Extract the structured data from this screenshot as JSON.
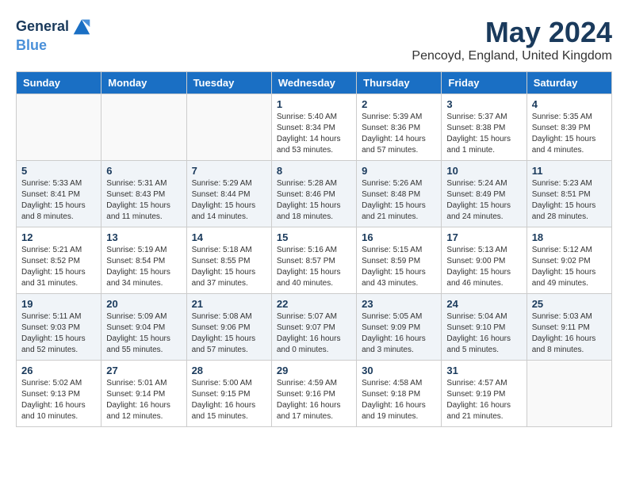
{
  "header": {
    "logo_line1": "General",
    "logo_line2": "Blue",
    "title": "May 2024",
    "location": "Pencoyd, England, United Kingdom"
  },
  "days_of_week": [
    "Sunday",
    "Monday",
    "Tuesday",
    "Wednesday",
    "Thursday",
    "Friday",
    "Saturday"
  ],
  "weeks": [
    [
      {
        "day": "",
        "info": ""
      },
      {
        "day": "",
        "info": ""
      },
      {
        "day": "",
        "info": ""
      },
      {
        "day": "1",
        "info": "Sunrise: 5:40 AM\nSunset: 8:34 PM\nDaylight: 14 hours\nand 53 minutes."
      },
      {
        "day": "2",
        "info": "Sunrise: 5:39 AM\nSunset: 8:36 PM\nDaylight: 14 hours\nand 57 minutes."
      },
      {
        "day": "3",
        "info": "Sunrise: 5:37 AM\nSunset: 8:38 PM\nDaylight: 15 hours\nand 1 minute."
      },
      {
        "day": "4",
        "info": "Sunrise: 5:35 AM\nSunset: 8:39 PM\nDaylight: 15 hours\nand 4 minutes."
      }
    ],
    [
      {
        "day": "5",
        "info": "Sunrise: 5:33 AM\nSunset: 8:41 PM\nDaylight: 15 hours\nand 8 minutes."
      },
      {
        "day": "6",
        "info": "Sunrise: 5:31 AM\nSunset: 8:43 PM\nDaylight: 15 hours\nand 11 minutes."
      },
      {
        "day": "7",
        "info": "Sunrise: 5:29 AM\nSunset: 8:44 PM\nDaylight: 15 hours\nand 14 minutes."
      },
      {
        "day": "8",
        "info": "Sunrise: 5:28 AM\nSunset: 8:46 PM\nDaylight: 15 hours\nand 18 minutes."
      },
      {
        "day": "9",
        "info": "Sunrise: 5:26 AM\nSunset: 8:48 PM\nDaylight: 15 hours\nand 21 minutes."
      },
      {
        "day": "10",
        "info": "Sunrise: 5:24 AM\nSunset: 8:49 PM\nDaylight: 15 hours\nand 24 minutes."
      },
      {
        "day": "11",
        "info": "Sunrise: 5:23 AM\nSunset: 8:51 PM\nDaylight: 15 hours\nand 28 minutes."
      }
    ],
    [
      {
        "day": "12",
        "info": "Sunrise: 5:21 AM\nSunset: 8:52 PM\nDaylight: 15 hours\nand 31 minutes."
      },
      {
        "day": "13",
        "info": "Sunrise: 5:19 AM\nSunset: 8:54 PM\nDaylight: 15 hours\nand 34 minutes."
      },
      {
        "day": "14",
        "info": "Sunrise: 5:18 AM\nSunset: 8:55 PM\nDaylight: 15 hours\nand 37 minutes."
      },
      {
        "day": "15",
        "info": "Sunrise: 5:16 AM\nSunset: 8:57 PM\nDaylight: 15 hours\nand 40 minutes."
      },
      {
        "day": "16",
        "info": "Sunrise: 5:15 AM\nSunset: 8:59 PM\nDaylight: 15 hours\nand 43 minutes."
      },
      {
        "day": "17",
        "info": "Sunrise: 5:13 AM\nSunset: 9:00 PM\nDaylight: 15 hours\nand 46 minutes."
      },
      {
        "day": "18",
        "info": "Sunrise: 5:12 AM\nSunset: 9:02 PM\nDaylight: 15 hours\nand 49 minutes."
      }
    ],
    [
      {
        "day": "19",
        "info": "Sunrise: 5:11 AM\nSunset: 9:03 PM\nDaylight: 15 hours\nand 52 minutes."
      },
      {
        "day": "20",
        "info": "Sunrise: 5:09 AM\nSunset: 9:04 PM\nDaylight: 15 hours\nand 55 minutes."
      },
      {
        "day": "21",
        "info": "Sunrise: 5:08 AM\nSunset: 9:06 PM\nDaylight: 15 hours\nand 57 minutes."
      },
      {
        "day": "22",
        "info": "Sunrise: 5:07 AM\nSunset: 9:07 PM\nDaylight: 16 hours\nand 0 minutes."
      },
      {
        "day": "23",
        "info": "Sunrise: 5:05 AM\nSunset: 9:09 PM\nDaylight: 16 hours\nand 3 minutes."
      },
      {
        "day": "24",
        "info": "Sunrise: 5:04 AM\nSunset: 9:10 PM\nDaylight: 16 hours\nand 5 minutes."
      },
      {
        "day": "25",
        "info": "Sunrise: 5:03 AM\nSunset: 9:11 PM\nDaylight: 16 hours\nand 8 minutes."
      }
    ],
    [
      {
        "day": "26",
        "info": "Sunrise: 5:02 AM\nSunset: 9:13 PM\nDaylight: 16 hours\nand 10 minutes."
      },
      {
        "day": "27",
        "info": "Sunrise: 5:01 AM\nSunset: 9:14 PM\nDaylight: 16 hours\nand 12 minutes."
      },
      {
        "day": "28",
        "info": "Sunrise: 5:00 AM\nSunset: 9:15 PM\nDaylight: 16 hours\nand 15 minutes."
      },
      {
        "day": "29",
        "info": "Sunrise: 4:59 AM\nSunset: 9:16 PM\nDaylight: 16 hours\nand 17 minutes."
      },
      {
        "day": "30",
        "info": "Sunrise: 4:58 AM\nSunset: 9:18 PM\nDaylight: 16 hours\nand 19 minutes."
      },
      {
        "day": "31",
        "info": "Sunrise: 4:57 AM\nSunset: 9:19 PM\nDaylight: 16 hours\nand 21 minutes."
      },
      {
        "day": "",
        "info": ""
      }
    ]
  ]
}
